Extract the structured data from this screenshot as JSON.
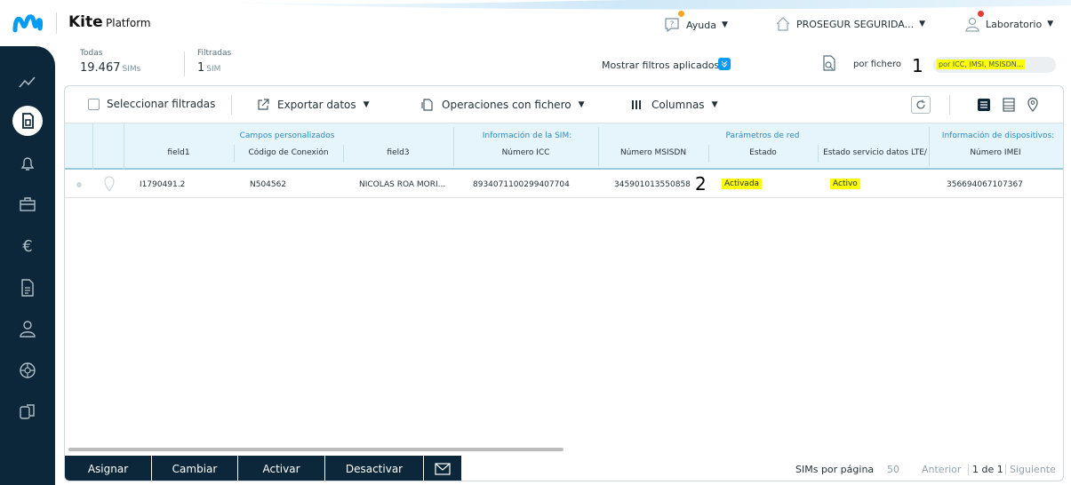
{
  "app": {
    "brand": "Kite",
    "brand_sub": "Platform"
  },
  "topnav": {
    "help": "Ayuda",
    "company": "PROSEGUR SEGURIDA...",
    "user": "Laboratorio"
  },
  "colors": {
    "sidebar": "#0b2739",
    "accent": "#019df4",
    "highlight": "#ffff00",
    "header_bg": "#e6f4fb"
  },
  "summary": {
    "all_label": "Todas",
    "all_value": "19.467",
    "all_unit": "SIMs",
    "filtered_label": "Filtradas",
    "filtered_value": "1",
    "filtered_unit": "SIM",
    "show_filters": "Mostrar filtros aplicados",
    "by_file": "por fichero",
    "search_placeholder": "por ICC, IMSI, MSISDN...",
    "annotation_1": "1"
  },
  "sidebar": {
    "items": [
      "chart-icon",
      "sim-card-icon",
      "bell-icon",
      "briefcase-icon",
      "euro-icon",
      "document-icon",
      "user-icon",
      "network-icon",
      "devices-icon"
    ]
  },
  "toolbar": {
    "select_filtered": "Seleccionar filtradas",
    "export": "Exportar datos",
    "file_ops": "Operaciones con fichero",
    "columns": "Columnas"
  },
  "table": {
    "groups": {
      "custom": "Campos personalizados",
      "sim_info": "Información de la SIM:",
      "network": "Parámetros de red",
      "devices": "Información de dispositivos:"
    },
    "columns": [
      "field1",
      "Código de Conexión",
      "field3",
      "Número ICC",
      "Número MSISDN",
      "Estado",
      "Estado servicio datos LTE/",
      "Número IMEI"
    ],
    "rows": [
      {
        "field1": "I1790491.2",
        "conexion": "N504562",
        "field3": "NICOLAS ROA MORI...",
        "icc": "8934071100299407704",
        "msisdn": "345901013550858",
        "annotation": "2",
        "estado": "Activada",
        "lte": "Activo",
        "imei": "356694067107367"
      }
    ]
  },
  "actions": {
    "assign": "Asignar",
    "change": "Cambiar",
    "activate": "Activar",
    "deactivate": "Desactivar"
  },
  "pagination": {
    "per_page_label": "SIMs por página",
    "per_page": "50",
    "prev": "Anterior",
    "page": "1 de 1",
    "next": "Siguiente"
  }
}
